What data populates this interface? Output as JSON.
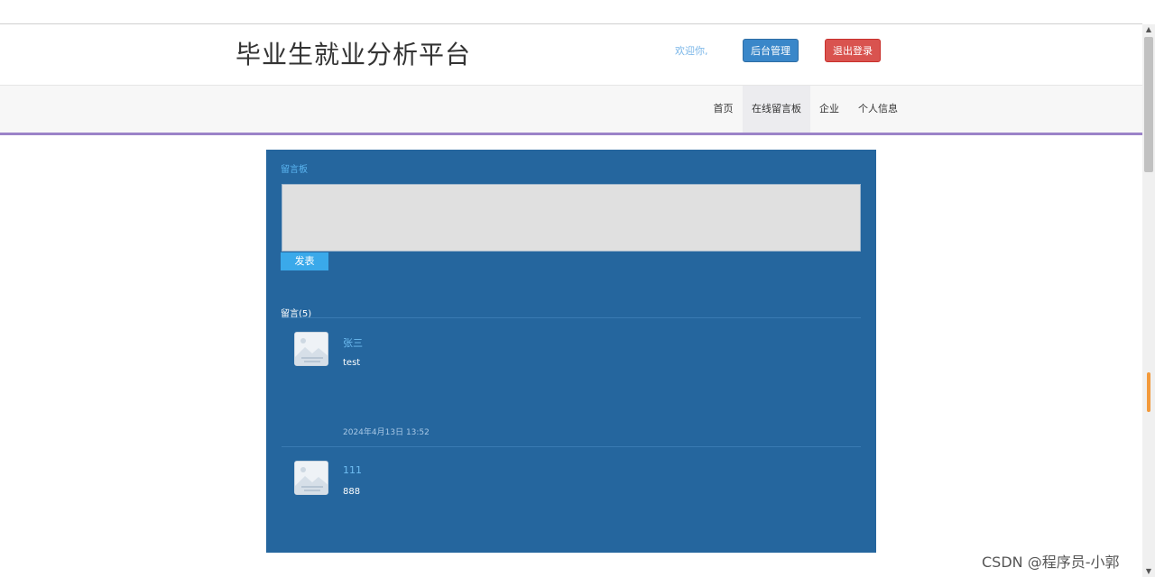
{
  "header": {
    "title": "毕业生就业分析平台",
    "welcome": "欢迎你,",
    "admin_button": "后台管理",
    "logout_button": "退出登录"
  },
  "nav": {
    "items": [
      {
        "label": "首页"
      },
      {
        "label": "在线留言板",
        "active": true
      },
      {
        "label": "企业"
      },
      {
        "label": "个人信息"
      }
    ]
  },
  "board": {
    "title": "留言板",
    "textarea_value": "",
    "post_button": "发表",
    "count_label": "留言(5)",
    "messages": [
      {
        "user": "张三",
        "text": "test",
        "time": "2024年4月13日 13:52"
      },
      {
        "user": "111",
        "text": "888",
        "time": ""
      }
    ]
  },
  "watermark": "CSDN @程序员-小郭",
  "colors": {
    "board_bg": "#25669e",
    "nav_underline": "#9b83c8",
    "admin_button": "#3a87c9",
    "logout_button": "#d9534f",
    "post_button": "#3aa9ea"
  }
}
